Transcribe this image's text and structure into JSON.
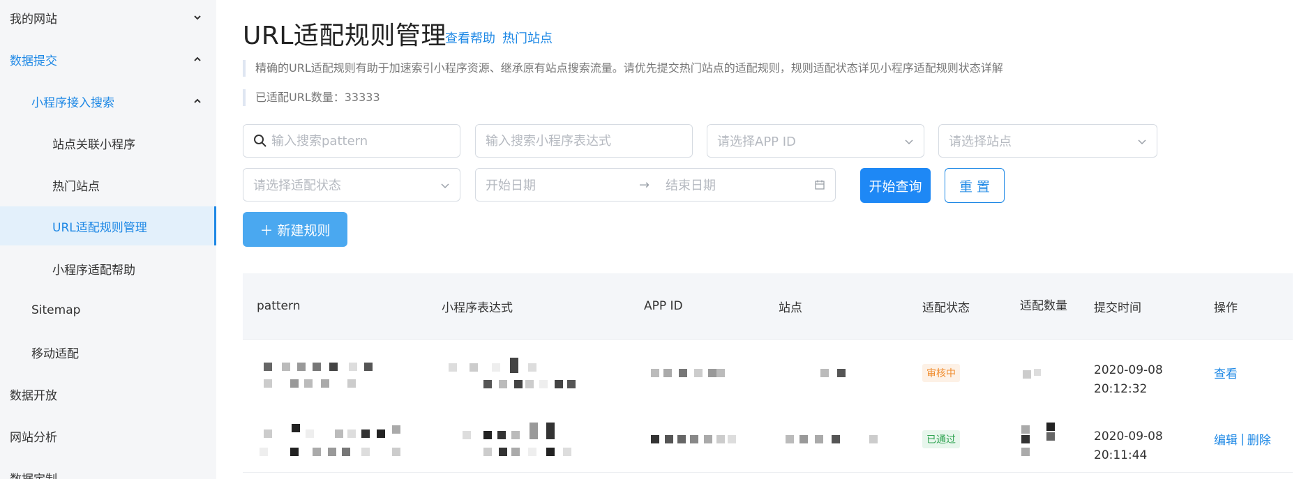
{
  "sidebar": {
    "items": [
      {
        "label": "我的网站"
      },
      {
        "label": "数据提交"
      },
      {
        "label": "小程序接入搜索"
      },
      {
        "label": "站点关联小程序"
      },
      {
        "label": "热门站点"
      },
      {
        "label": "URL适配规则管理"
      },
      {
        "label": "小程序适配帮助"
      },
      {
        "label": "Sitemap"
      },
      {
        "label": "移动适配"
      },
      {
        "label": "数据开放"
      },
      {
        "label": "网站分析"
      },
      {
        "label": "数据定制"
      }
    ]
  },
  "header": {
    "title": "URL适配规则管理",
    "help_link": "查看帮助",
    "hot_link": "热门站点"
  },
  "notes": {
    "desc": "精确的URL适配规则有助于加速索引小程序资源、继承原有站点搜索流量。请优先提交热门站点的适配规则，规则适配状态详见小程序适配规则状态详解",
    "count": "已适配URL数量：33333"
  },
  "filters": {
    "pattern_placeholder": "输入搜索pattern",
    "expr_placeholder": "输入搜索小程序表达式",
    "appid_placeholder": "请选择APP ID",
    "site_placeholder": "请选择站点",
    "status_placeholder": "请选择适配状态",
    "start_placeholder": "开始日期",
    "end_placeholder": "结束日期",
    "range_sep": "→"
  },
  "buttons": {
    "query": "开始查询",
    "reset": "重 置",
    "new_rule": "＋  新建规则"
  },
  "table": {
    "headers": [
      "pattern",
      "小程序表达式",
      "APP ID",
      "站点",
      "适配状态",
      "适配数量",
      "提交时间",
      "操作"
    ],
    "rows": [
      {
        "status": "审核中",
        "time_date": "2020-09-08",
        "time_clock": "20:12:32",
        "action_view": "查看"
      },
      {
        "status": "已通过",
        "time_date": "2020-09-08",
        "time_clock": "20:11:44",
        "action_edit": "编辑",
        "action_sep": "|",
        "action_delete": "删除"
      }
    ]
  },
  "colors": {
    "accent": "#1e88e5",
    "pending": "#f08c2d",
    "passed": "#2ea350"
  }
}
